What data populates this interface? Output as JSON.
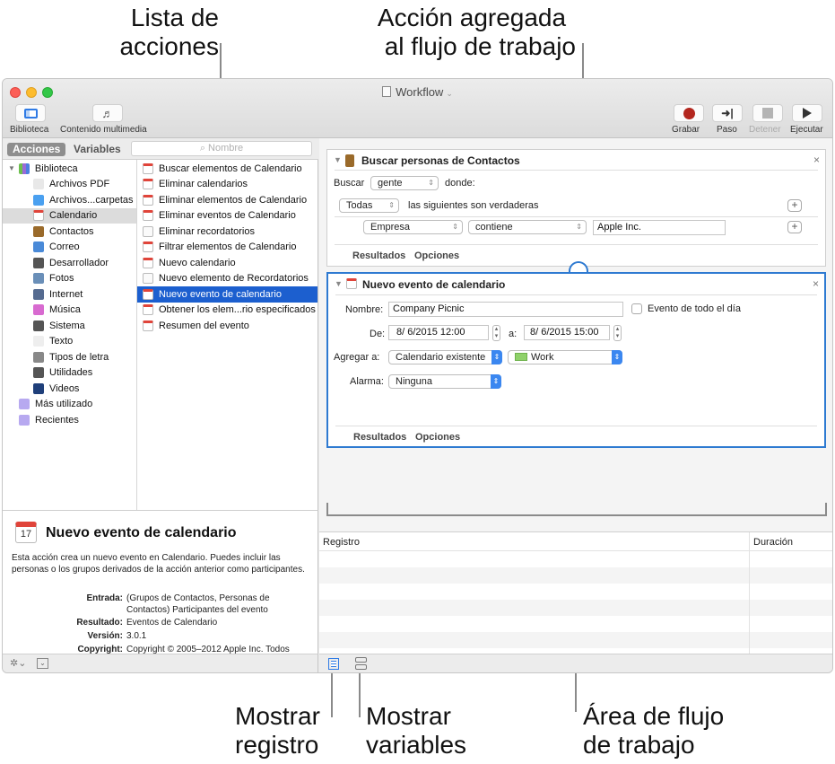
{
  "callouts": {
    "actions_list": [
      "Lista de",
      "acciones"
    ],
    "added_action": [
      "Acción agregada",
      "al flujo de trabajo"
    ],
    "show_log": [
      "Mostrar",
      "registro"
    ],
    "show_variables": [
      "Mostrar",
      "variables"
    ],
    "workflow_area": [
      "Área de flujo",
      "de trabajo"
    ]
  },
  "window": {
    "title": "Workflow",
    "toolbar_left": [
      {
        "label": "Biblioteca",
        "icon": "library-icon"
      },
      {
        "label": "Contenido multimedia",
        "icon": "media-icon"
      }
    ],
    "toolbar_right": [
      {
        "label": "Grabar",
        "icon": "record-icon",
        "enabled": true
      },
      {
        "label": "Paso",
        "icon": "step-icon",
        "enabled": true
      },
      {
        "label": "Detener",
        "icon": "stop-icon",
        "enabled": false
      },
      {
        "label": "Ejecutar",
        "icon": "run-icon",
        "enabled": true
      }
    ],
    "colors": {
      "record": "#b3261e",
      "selection": "#1c5fcf",
      "active_border": "#2e7ad1"
    }
  },
  "library": {
    "tabs": [
      "Acciones",
      "Variables"
    ],
    "active_tab": "Acciones",
    "search_placeholder": "Nombre",
    "root": "Biblioteca",
    "items": [
      "Archivos PDF",
      "Archivos...carpetas",
      "Calendario",
      "Contactos",
      "Correo",
      "Desarrollador",
      "Fotos",
      "Internet",
      "Música",
      "Sistema",
      "Texto",
      "Tipos de letra",
      "Utilidades",
      "Videos"
    ],
    "selected": "Calendario",
    "smart_groups": [
      "Más utilizado",
      "Recientes"
    ]
  },
  "actions": {
    "items": [
      "Buscar elementos de Calendario",
      "Eliminar calendarios",
      "Eliminar elementos de Calendario",
      "Eliminar eventos de Calendario",
      "Eliminar recordatorios",
      "Filtrar elementos de Calendario",
      "Nuevo calendario",
      "Nuevo elemento de Recordatorios",
      "Nuevo evento de calendario",
      "Obtener los elem...rio especificados",
      "Resumen del evento"
    ],
    "selected": "Nuevo evento de calendario"
  },
  "description": {
    "title": "Nuevo evento de calendario",
    "text": "Esta acción crea un nuevo evento en Calendario. Puedes incluir las personas o los grupos derivados de la acción anterior como participantes.",
    "entrada_label": "Entrada:",
    "entrada_value_1": "(Grupos de Contactos, Personas de",
    "entrada_value_2": "Contactos) Participantes del evento",
    "resultado_label": "Resultado:",
    "resultado_value": "Eventos de Calendario",
    "version_label": "Versión:",
    "version_value": "3.0.1",
    "copyright_label": "Copyright:",
    "copyright_value": "Copyright © 2005–2012 Apple Inc. Todos"
  },
  "workflow": {
    "card1": {
      "title": "Buscar personas de Contactos",
      "buscar_label": "Buscar",
      "buscar_value": "gente",
      "donde_label": "donde:",
      "match_value": "Todas",
      "match_label": "las siguientes son verdaderas",
      "field_value": "Empresa",
      "operator_value": "contiene",
      "text_value": "Apple Inc.",
      "footer_results": "Resultados",
      "footer_options": "Opciones"
    },
    "card2": {
      "title": "Nuevo evento de calendario",
      "nombre_label": "Nombre:",
      "nombre_value": "Company Picnic",
      "allday_label": "Evento de todo el día",
      "allday_checked": false,
      "de_label": "De:",
      "de_value": "8/  6/2015 12:00",
      "a_label": "a:",
      "a_value": "8/  6/2015 15:00",
      "agregar_label": "Agregar a:",
      "agregar_value": "Calendario existente",
      "calendar_value": "Work",
      "calendar_color": "#8fd16a",
      "alarma_label": "Alarma:",
      "alarma_value": "Ninguna",
      "footer_results": "Resultados",
      "footer_options": "Opciones"
    }
  },
  "log": {
    "columns": [
      "Registro",
      "Duración"
    ],
    "rows": []
  }
}
